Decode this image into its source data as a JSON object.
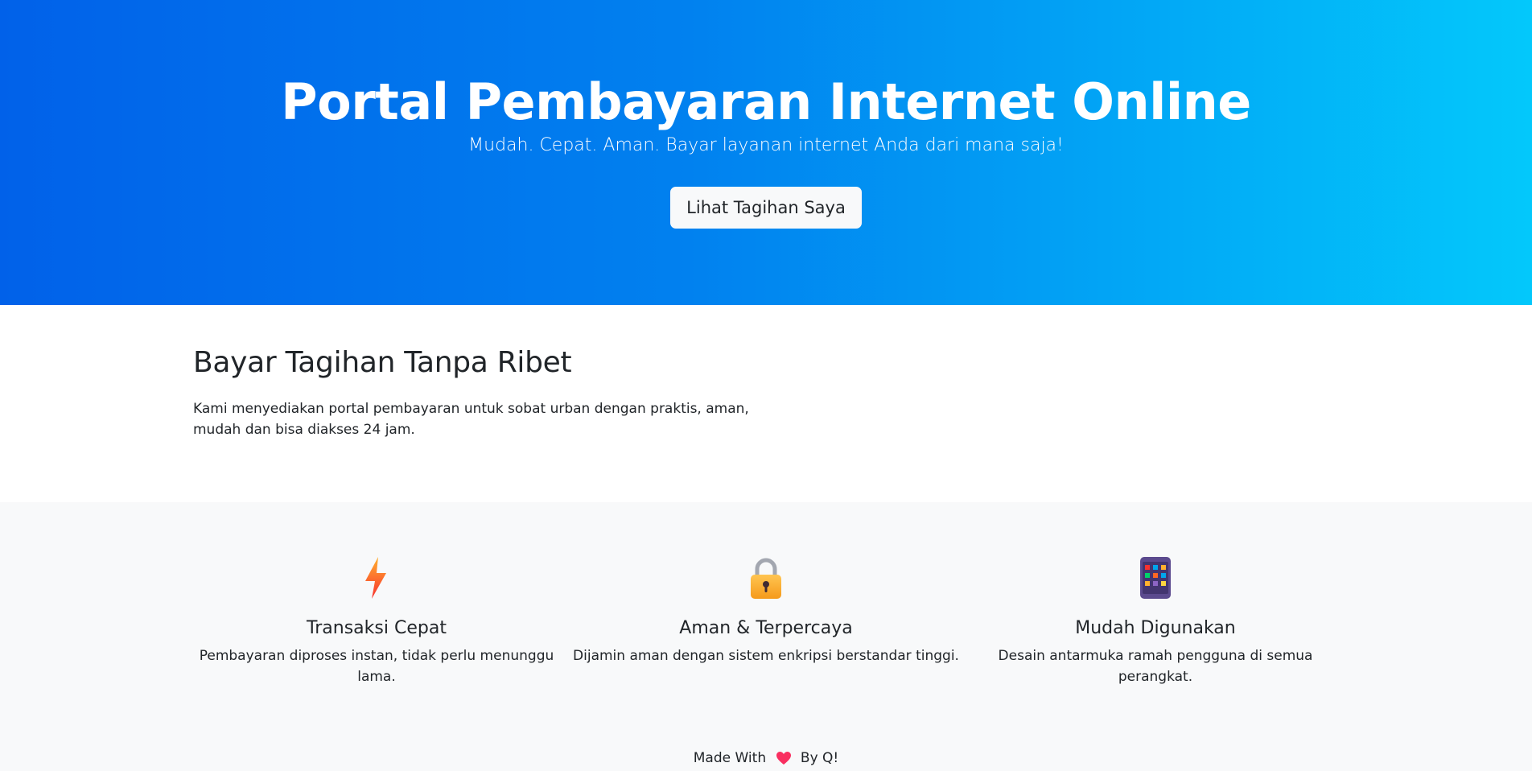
{
  "hero": {
    "title": "Portal Pembayaran Internet Online",
    "subtitle": "Mudah. Cepat. Aman. Bayar layanan internet Anda dari mana saja!",
    "button_label": "Lihat Tagihan Saya"
  },
  "intro": {
    "heading": "Bayar Tagihan Tanpa Ribet",
    "body": "Kami menyediakan portal pembayaran untuk sobat urban dengan praktis, aman, mudah dan bisa diakses 24 jam."
  },
  "features": [
    {
      "icon": "lightning-icon",
      "title": "Transaksi Cepat",
      "description": "Pembayaran diproses instan, tidak perlu menunggu lama."
    },
    {
      "icon": "lock-icon",
      "title": "Aman & Terpercaya",
      "description": "Dijamin aman dengan sistem enkripsi berstandar tinggi."
    },
    {
      "icon": "phone-icon",
      "title": "Mudah Digunakan",
      "description": "Desain antarmuka ramah pengguna di semua perangkat."
    }
  ],
  "footer": {
    "prefix": "Made With",
    "suffix": "By Q!"
  },
  "colors": {
    "hero_gradient_start": "#0161e9",
    "hero_gradient_end": "#03c8fb",
    "section_bg": "#f8f9fa"
  }
}
